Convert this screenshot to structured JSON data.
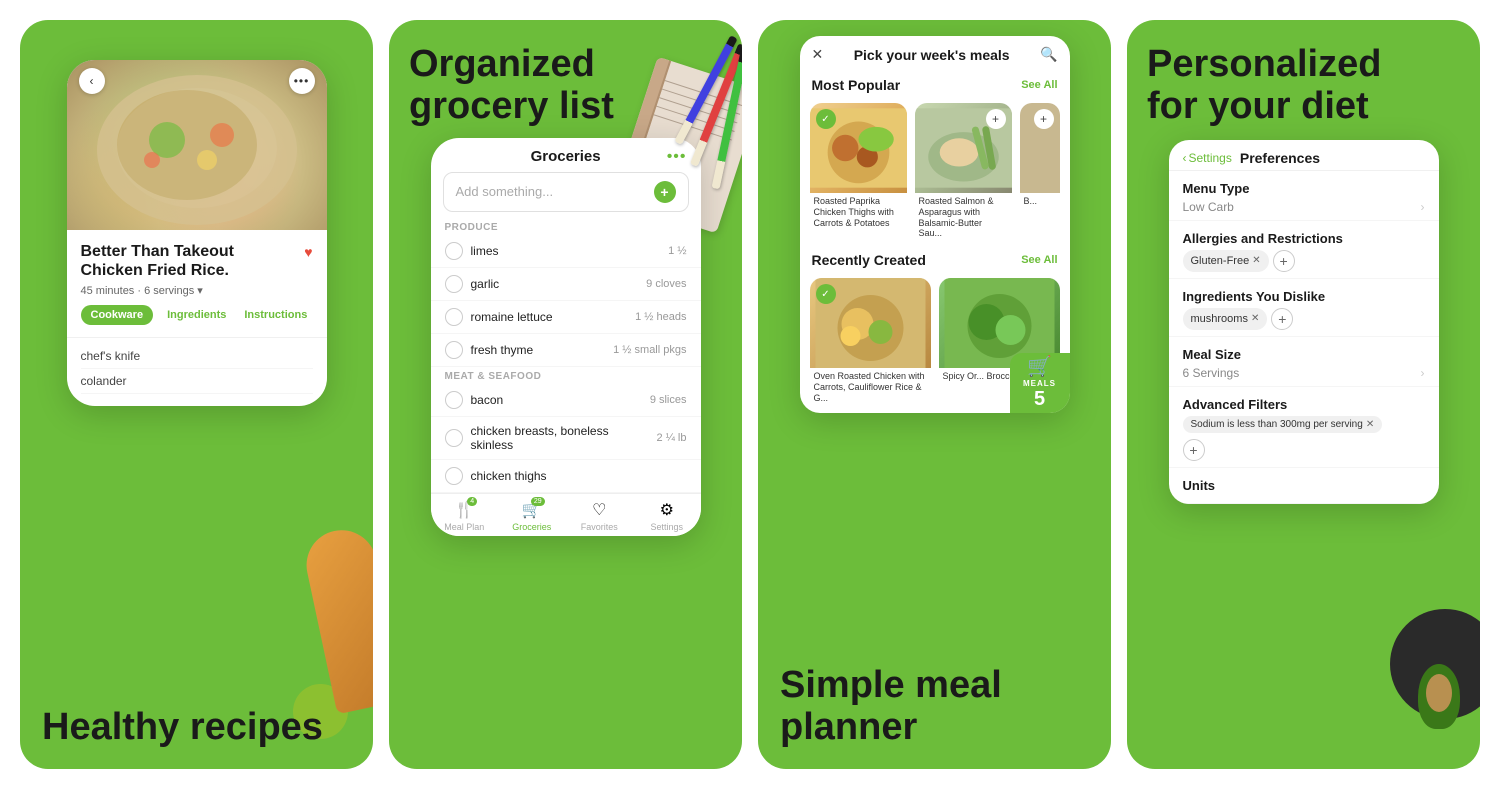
{
  "panel1": {
    "big_label": "Healthy\nrecipes",
    "recipe_title": "Better Than Takeout Chicken Fried Rice.",
    "recipe_meta": "45 minutes · 6 servings ▾",
    "tabs": [
      "Cookware",
      "Ingredients",
      "Instructions"
    ],
    "equipment": [
      "chef's knife",
      "colander"
    ],
    "nav_back": "‹",
    "nav_more": "•••"
  },
  "panel2": {
    "title": "Organized\ngrocery list",
    "groceries_title": "Groceries",
    "add_placeholder": "Add something...",
    "sections": [
      {
        "label": "PRODUCE",
        "items": [
          {
            "name": "limes",
            "qty": "1 ½"
          },
          {
            "name": "garlic",
            "qty": "9 cloves"
          },
          {
            "name": "romaine lettuce",
            "qty": "1 ½ heads"
          },
          {
            "name": "fresh thyme",
            "qty": "1 ½ small pkgs"
          }
        ]
      },
      {
        "label": "MEAT & SEAFOOD",
        "items": [
          {
            "name": "bacon",
            "qty": "9 slices"
          },
          {
            "name": "chicken breasts, boneless skinless",
            "qty": "2 ¼ lb"
          },
          {
            "name": "chicken thighs",
            "qty": ""
          }
        ]
      }
    ],
    "bottom_tabs": [
      {
        "label": "Meal Plan",
        "badge": "4",
        "active": false
      },
      {
        "label": "Groceries",
        "badge": "29",
        "active": true
      },
      {
        "label": "Favorites",
        "badge": "",
        "active": false
      },
      {
        "label": "Settings",
        "badge": "",
        "active": false
      }
    ]
  },
  "panel3": {
    "title": "Simple meal\nplanner",
    "header_title": "Pick your week's meals",
    "most_popular_label": "Most Popular",
    "see_all_1": "See All",
    "recently_created_label": "Recently Created",
    "see_all_2": "See All",
    "meals": [
      {
        "name": "Roasted Paprika Chicken Thighs with Carrots & Potatoes",
        "checked": true,
        "add": false
      },
      {
        "name": "Roasted Salmon & Asparagus with Balsamic-Butter Sau...",
        "checked": false,
        "add": true
      },
      {
        "name": "B...",
        "checked": false,
        "add": true
      },
      {
        "name": "Oven Roasted Chicken with Carrots, Cauliflower Rice & G...",
        "checked": true,
        "add": false
      },
      {
        "name": "Spicy Or... Broccoli...",
        "checked": false,
        "add": true
      }
    ],
    "cart_label": "MEALS",
    "cart_count": "5"
  },
  "panel4": {
    "title": "Personalized\nfor your diet",
    "back_label": "‹ Settings",
    "tab_label": "Preferences",
    "menu_type_label": "Menu Type",
    "menu_type_value": "Low Carb",
    "allergies_label": "Allergies and Restrictions",
    "allergies_chips": [
      "Gluten-Free"
    ],
    "dislike_label": "Ingredients You Dislike",
    "dislike_chips": [
      "mushrooms"
    ],
    "meal_size_label": "Meal Size",
    "meal_size_value": "6 Servings",
    "advanced_label": "Advanced Filters",
    "advanced_filter": "Sodium is less than 300mg per serving",
    "units_label": "Units"
  },
  "colors": {
    "green": "#6cbd3a",
    "dark": "#1a1a1a",
    "white": "#ffffff"
  }
}
